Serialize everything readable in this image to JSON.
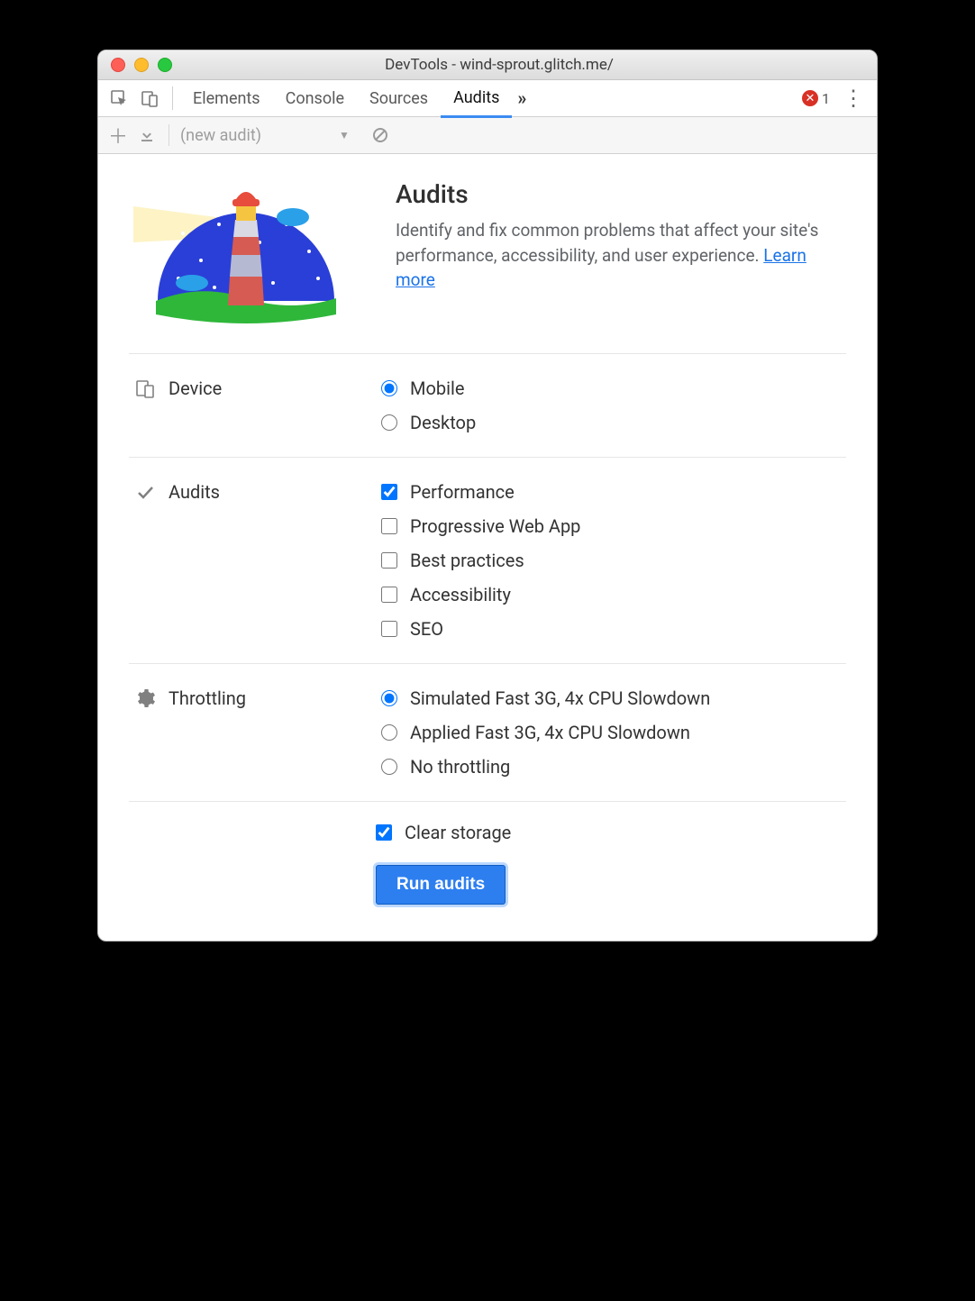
{
  "window": {
    "title": "DevTools - wind-sprout.glitch.me/"
  },
  "tabstrip": {
    "tabs": [
      "Elements",
      "Console",
      "Sources",
      "Audits"
    ],
    "active_tab": "Audits",
    "overflow_glyph": "»",
    "error_count": "1",
    "kebab_glyph": "⋮"
  },
  "subbar": {
    "dropdown_label": "(new audit)"
  },
  "hero": {
    "title": "Audits",
    "description": "Identify and fix common problems that affect your site's performance, accessibility, and user experience. ",
    "learn_more": "Learn more"
  },
  "sections": {
    "device": {
      "label": "Device",
      "options": [
        {
          "label": "Mobile",
          "checked": true
        },
        {
          "label": "Desktop",
          "checked": false
        }
      ]
    },
    "audits": {
      "label": "Audits",
      "options": [
        {
          "label": "Performance",
          "checked": true
        },
        {
          "label": "Progressive Web App",
          "checked": false
        },
        {
          "label": "Best practices",
          "checked": false
        },
        {
          "label": "Accessibility",
          "checked": false
        },
        {
          "label": "SEO",
          "checked": false
        }
      ]
    },
    "throttling": {
      "label": "Throttling",
      "options": [
        {
          "label": "Simulated Fast 3G, 4x CPU Slowdown",
          "checked": true
        },
        {
          "label": "Applied Fast 3G, 4x CPU Slowdown",
          "checked": false
        },
        {
          "label": "No throttling",
          "checked": false
        }
      ]
    }
  },
  "footer": {
    "clear_storage": {
      "label": "Clear storage",
      "checked": true
    },
    "run_button": "Run audits"
  }
}
